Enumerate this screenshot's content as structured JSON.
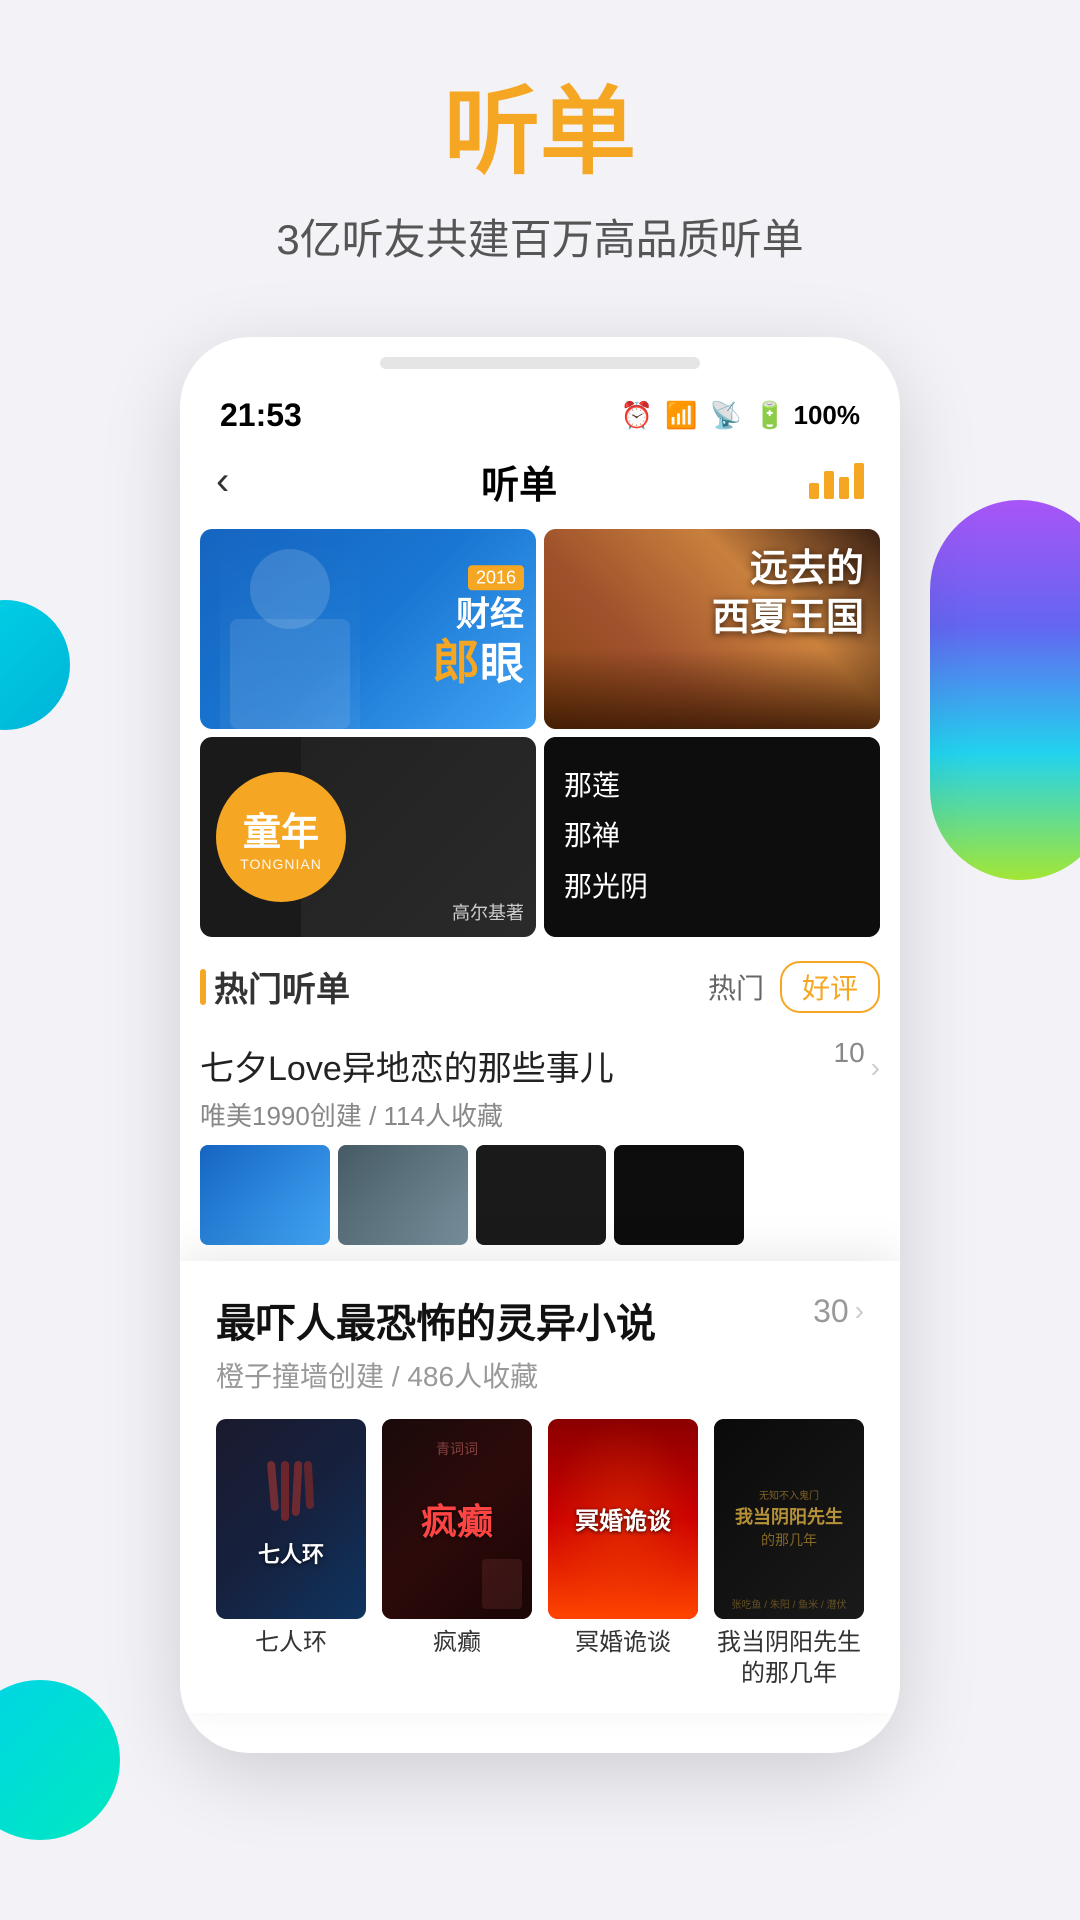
{
  "page": {
    "bg_color": "#f2f2f7"
  },
  "header": {
    "main_title": "听单",
    "sub_title": "3亿听友共建百万高品质听单"
  },
  "status_bar": {
    "time": "21:53",
    "battery": "100%",
    "battery_icon": "🔋"
  },
  "nav": {
    "back_label": "‹",
    "title": "听单"
  },
  "featured_cards": [
    {
      "id": "card1",
      "year": "2016",
      "title_part1": "财经",
      "title_highlight": "郎",
      "title_part2": "眼",
      "bg": "blue"
    },
    {
      "id": "card2",
      "title_line1": "远去的",
      "title_line2": "西夏王国",
      "bg": "desert"
    },
    {
      "id": "card3",
      "circle_title": "童年",
      "circle_subtitle": "TONGNIAN",
      "author": "高尔基著",
      "bg": "dark"
    },
    {
      "id": "card4",
      "title_lines": [
        "那莲",
        "那禅",
        "那光阴"
      ],
      "bg": "black"
    }
  ],
  "hot_section": {
    "title": "热门听单",
    "filter_normal": "热门",
    "filter_active": "好评"
  },
  "playlist_1": {
    "title": "七夕Love异地恋的那些事儿",
    "creator": "唯美1990创建",
    "collectors": "114人收藏",
    "count": "10"
  },
  "playlist_2": {
    "title": "最吓人最恐怖的灵异小说",
    "creator": "橙子撞墙创建",
    "collectors": "486人收藏",
    "count": "30"
  },
  "books": [
    {
      "id": "book1",
      "cover_text": "七人环",
      "title": "七人环"
    },
    {
      "id": "book2",
      "cover_text": "疯癫",
      "title": "疯癫"
    },
    {
      "id": "book3",
      "cover_text": "冥婚诡谈",
      "title": "冥婚诡谈"
    },
    {
      "id": "book4",
      "cover_text": "我当阴阳先生的那几年",
      "title": "我当阴阳先生的那几年"
    }
  ]
}
